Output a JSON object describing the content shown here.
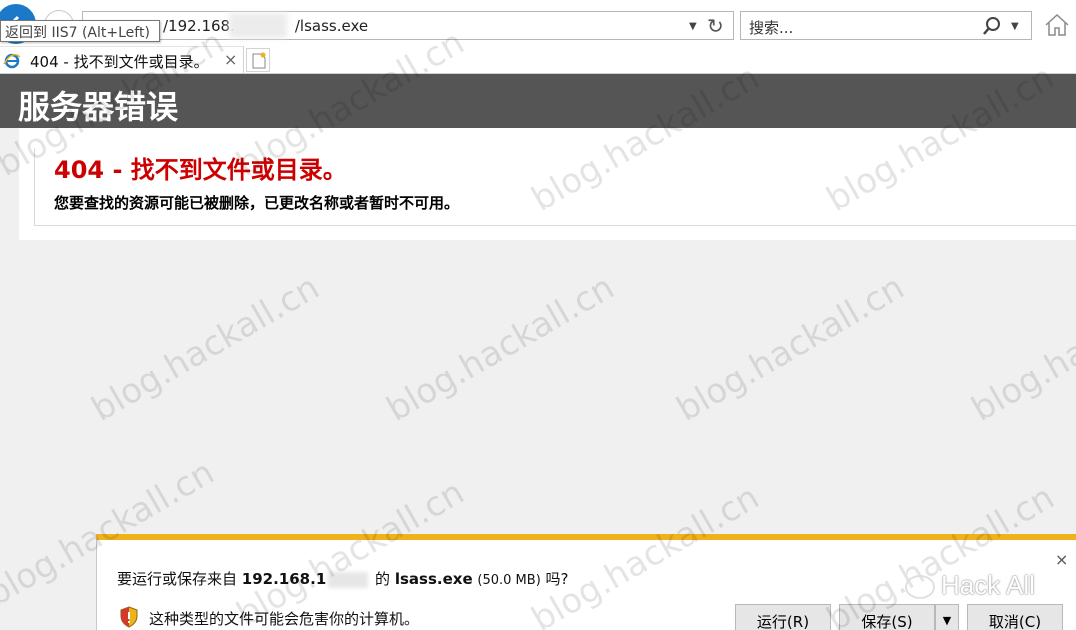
{
  "browser": {
    "address": {
      "prefix": "/192.168.",
      "suffix": "/lsass.exe"
    },
    "search": {
      "placeholder": "搜索..."
    },
    "tooltip": "返回到 IIS7 (Alt+Left)",
    "tab": {
      "title": "404 - 找不到文件或目录。",
      "close": "×"
    }
  },
  "page": {
    "header": "服务器错误",
    "error_title": "404 - 找不到文件或目录。",
    "error_desc": "您要查找的资源可能已被删除，已更改名称或者暂时不可用。"
  },
  "download_bar": {
    "close": "×",
    "prompt_start": "要运行或保存来自",
    "host": "192.168.1",
    "prompt_of": "的",
    "filename": "lsass.exe",
    "size": "(50.0 MB)",
    "prompt_end": "吗?",
    "warning": "这种类型的文件可能会危害你的计算机。",
    "buttons": {
      "run": "运行(R)",
      "save": "保存(S)",
      "save_dropdown": "▼",
      "cancel": "取消(C)"
    }
  },
  "watermark": "blog.hackall.cn",
  "logo": "Hack All",
  "colors": {
    "error_red": "#cc0000",
    "header_bg": "#555555",
    "notif_accent": "#f0b21b",
    "ie_blue": "#1b79c9"
  }
}
